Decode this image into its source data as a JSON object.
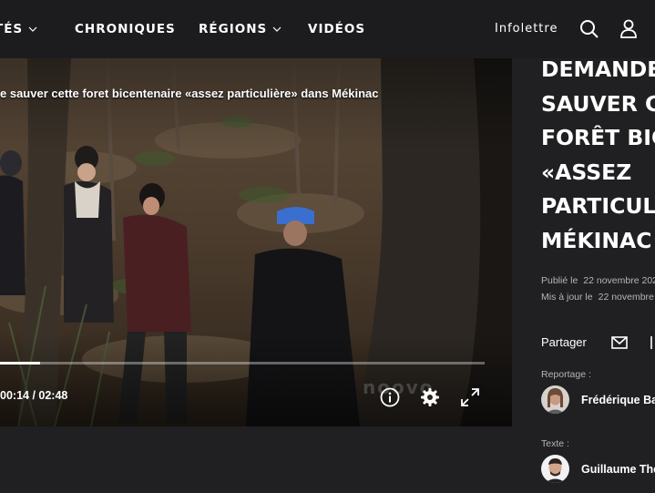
{
  "nav": {
    "items": [
      "TÉS",
      "CHRONIQUES",
      "RÉGIONS",
      "VIDÉOS"
    ],
    "newsletter": "Infolettre",
    "icons": {
      "search": "search-icon",
      "account": "user-icon"
    }
  },
  "video": {
    "title": "e sauver cette foret bicentenaire «assez particulière» dans Mékinac",
    "time": "00:14 / 02:48",
    "progress_fraction": 0.083,
    "watermark": "noovo",
    "icons": [
      "info-icon",
      "gear-icon",
      "fullscreen-icon"
    ]
  },
  "article": {
    "headline_lines": [
      "DEMANDE",
      "SAUVER C",
      "FORÊT BIC",
      "«ASSEZ",
      "PARTICUL",
      "MÉKINAC"
    ],
    "published_label": "Publié le",
    "published_value": "22 novembre 202",
    "updated_label": "Mis à jour le",
    "updated_value": "22 novembre",
    "share_label": "Partager",
    "reportage_label": "Reportage :",
    "reportage_author": "Frédérique Ba",
    "texte_label": "Texte :",
    "texte_author": "Guillaume The"
  },
  "colors": {
    "background": "#202022",
    "topbar": "#1c1c1e",
    "muted_text": "#b5b5b8"
  }
}
